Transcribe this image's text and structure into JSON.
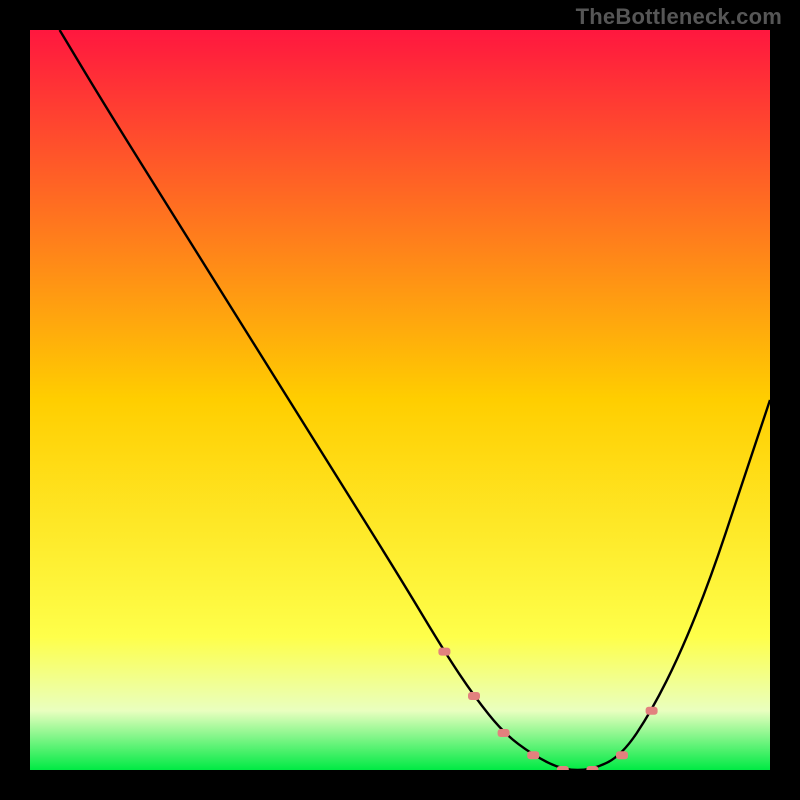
{
  "watermark": "TheBottleneck.com",
  "chart_data": {
    "type": "line",
    "title": "",
    "xlabel": "",
    "ylabel": "",
    "xlim": [
      0,
      100
    ],
    "ylim": [
      0,
      100
    ],
    "grid": false,
    "legend": null,
    "series": [
      {
        "name": "bottleneck-curve",
        "color": "#000000",
        "x": [
          4,
          10,
          20,
          30,
          40,
          50,
          56,
          60,
          64,
          68,
          72,
          76,
          80,
          84,
          88,
          92,
          96,
          100
        ],
        "y": [
          100,
          90,
          74,
          58,
          42,
          26,
          16,
          10,
          5,
          2,
          0,
          0,
          2,
          8,
          16,
          26,
          38,
          50
        ]
      }
    ],
    "green_band_y_range": [
      0,
      7
    ],
    "valley_markers_x": [
      56,
      60,
      64,
      68,
      72,
      76,
      80,
      84
    ],
    "marker_color": "#e2817e",
    "background_gradient_stops": [
      {
        "offset": 0.0,
        "color": "#ff173f"
      },
      {
        "offset": 0.5,
        "color": "#ffce00"
      },
      {
        "offset": 0.82,
        "color": "#feff4a"
      },
      {
        "offset": 0.92,
        "color": "#e9ffbf"
      },
      {
        "offset": 1.0,
        "color": "#00ea44"
      }
    ]
  }
}
